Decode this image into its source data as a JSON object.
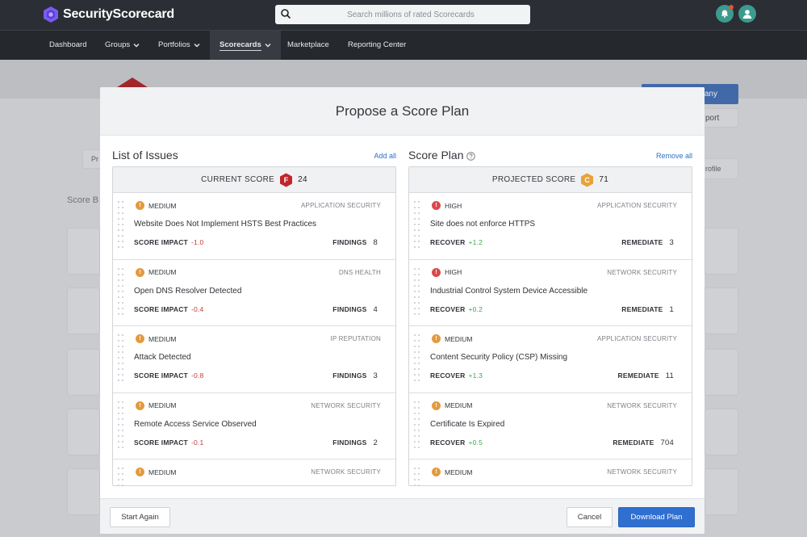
{
  "app": {
    "name": "SecurityScorecard"
  },
  "search": {
    "placeholder": "Search millions of rated Scorecards"
  },
  "colors": {
    "accent": "#2f6fd0",
    "grade_f": "#c0262c",
    "grade_c": "#e8a23a",
    "high": "#d94a4a",
    "medium": "#e39a3e",
    "positive": "#3aa84e",
    "negative": "#c53a3a"
  },
  "nav": {
    "items": [
      {
        "label": "Dashboard",
        "has_menu": false
      },
      {
        "label": "Groups",
        "has_menu": true
      },
      {
        "label": "Portfolios",
        "has_menu": true
      },
      {
        "label": "Scorecards",
        "has_menu": true,
        "active": true
      },
      {
        "label": "Marketplace",
        "has_menu": false
      },
      {
        "label": "Reporting Center",
        "has_menu": false
      }
    ]
  },
  "modal": {
    "title": "Propose a Score Plan",
    "left": {
      "title": "List of Issues",
      "action": "Add all",
      "score_label": "CURRENT SCORE",
      "grade": "F",
      "score": "24",
      "impact_label": "SCORE IMPACT",
      "count_label": "FINDINGS",
      "issues": [
        {
          "severity": "MEDIUM",
          "category": "APPLICATION SECURITY",
          "title": "Website Does Not Implement HSTS Best Practices",
          "impact": "-1.0",
          "count": "8"
        },
        {
          "severity": "MEDIUM",
          "category": "DNS HEALTH",
          "title": "Open DNS Resolver Detected",
          "impact": "-0.4",
          "count": "4"
        },
        {
          "severity": "MEDIUM",
          "category": "IP REPUTATION",
          "title": "Attack Detected",
          "impact": "-0.8",
          "count": "3"
        },
        {
          "severity": "MEDIUM",
          "category": "NETWORK SECURITY",
          "title": "Remote Access Service Observed",
          "impact": "-0.1",
          "count": "2"
        },
        {
          "severity": "MEDIUM",
          "category": "NETWORK SECURITY",
          "title": "",
          "impact": "",
          "count": ""
        }
      ]
    },
    "right": {
      "title": "Score Plan",
      "action": "Remove all",
      "score_label": "PROJECTED SCORE",
      "grade": "C",
      "score": "71",
      "impact_label": "RECOVER",
      "count_label": "REMEDIATE",
      "issues": [
        {
          "severity": "HIGH",
          "category": "APPLICATION SECURITY",
          "title": "Site does not enforce HTTPS",
          "impact": "+1.2",
          "count": "3"
        },
        {
          "severity": "HIGH",
          "category": "NETWORK SECURITY",
          "title": "Industrial Control System Device Accessible",
          "impact": "+0.2",
          "count": "1"
        },
        {
          "severity": "MEDIUM",
          "category": "APPLICATION SECURITY",
          "title": "Content Security Policy (CSP) Missing",
          "impact": "+1.3",
          "count": "11"
        },
        {
          "severity": "MEDIUM",
          "category": "NETWORK SECURITY",
          "title": "Certificate Is Expired",
          "impact": "+0.5",
          "count": "704"
        },
        {
          "severity": "MEDIUM",
          "category": "NETWORK SECURITY",
          "title": "",
          "impact": "",
          "count": ""
        }
      ]
    },
    "footer": {
      "start_again": "Start Again",
      "cancel": "Cancel",
      "download": "Download Plan"
    }
  },
  "background": {
    "score_heading_fragment": "Score B",
    "button_fragment": "any",
    "report_fragment": "port",
    "profile_fragment": "rofile",
    "pr_fragment": "Pr"
  }
}
